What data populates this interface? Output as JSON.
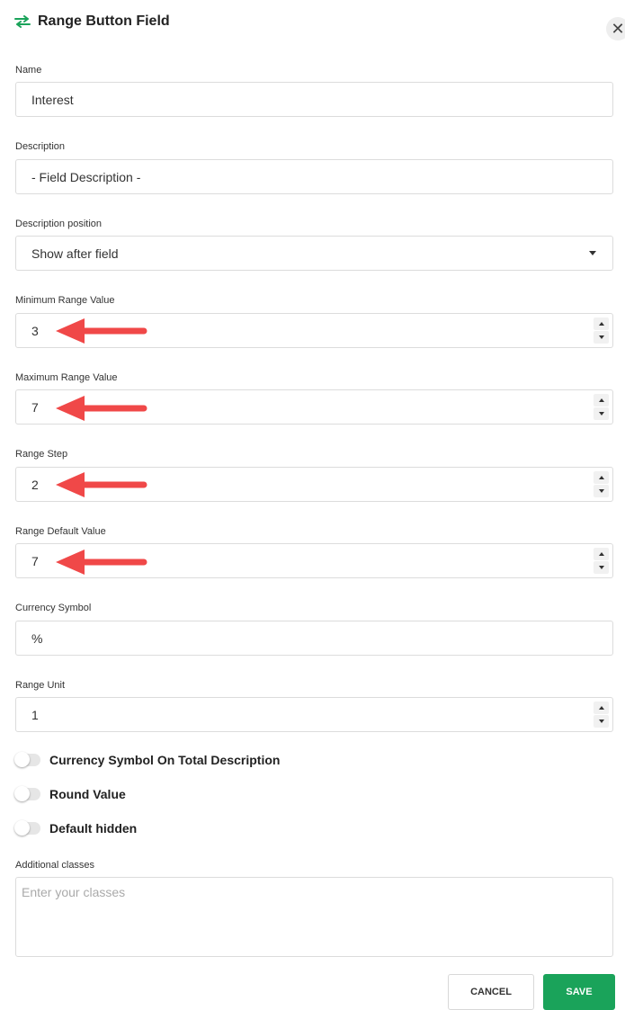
{
  "dialog": {
    "title": "Range Button Field",
    "close_symbol": "✕",
    "icon": "swap-arrows-icon",
    "accent_color": "#1aa35a"
  },
  "fields": {
    "name": {
      "label": "Name",
      "value": "Interest"
    },
    "description": {
      "label": "Description",
      "value": "- Field Description -"
    },
    "description_position": {
      "label": "Description position",
      "value": "Show after field"
    },
    "min_range": {
      "label": "Minimum Range Value",
      "value": "3"
    },
    "max_range": {
      "label": "Maximum Range Value",
      "value": "7"
    },
    "range_step": {
      "label": "Range Step",
      "value": "2"
    },
    "range_default": {
      "label": "Range Default Value",
      "value": "7"
    },
    "currency_symbol": {
      "label": "Currency Symbol",
      "value": "%"
    },
    "range_unit": {
      "label": "Range Unit",
      "value": "1"
    }
  },
  "toggles": {
    "currency_on_total": {
      "label": "Currency Symbol On Total Description",
      "on": false
    },
    "round_value": {
      "label": "Round Value",
      "on": false
    },
    "default_hidden": {
      "label": "Default hidden",
      "on": false
    }
  },
  "additional_classes": {
    "label": "Additional classes",
    "placeholder": "Enter your classes"
  },
  "buttons": {
    "cancel": "CANCEL",
    "save": "SAVE"
  },
  "annotation": {
    "arrow_color": "#f04848"
  }
}
